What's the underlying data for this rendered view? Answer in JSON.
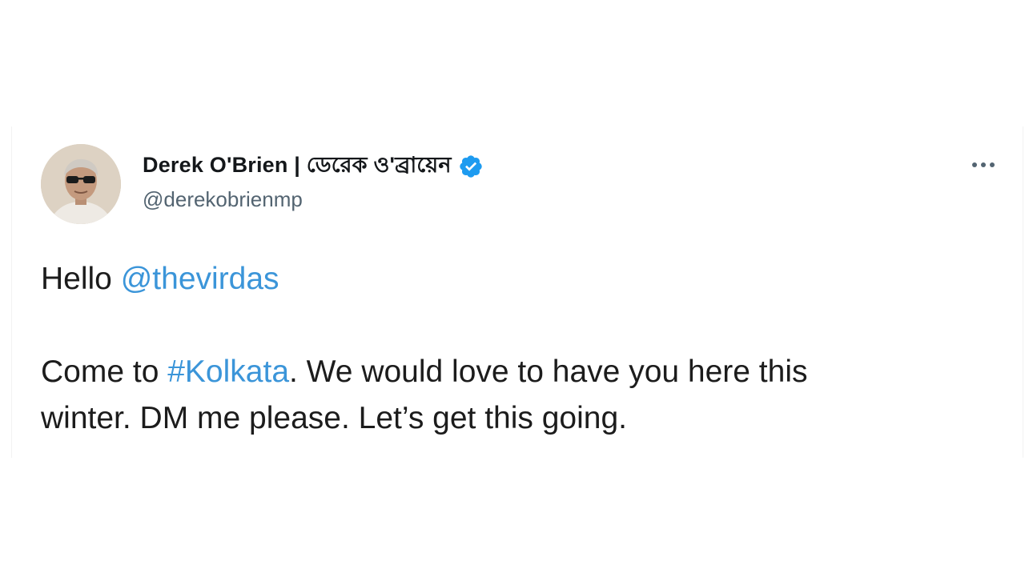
{
  "tweet": {
    "author": {
      "display_name": "Derek O'Brien | ডেরেক ও'ব্রায়েন",
      "handle": "@derekobrienmp",
      "verified": true,
      "avatar_icon": "profile-photo"
    },
    "more_icon": "more-horizontal-icon",
    "body": {
      "line1_prefix": "Hello ",
      "mention": "@thevirdas",
      "line2_prefix": "Come to ",
      "hashtag": "#Kolkata",
      "line2_suffix": ". We would love to have you here this",
      "line3": "winter. DM me please. Let’s get this going."
    }
  },
  "colors": {
    "link": "#3b95d9",
    "verified": "#1d9bf0",
    "text": "#1c1c1c",
    "secondary": "#536471"
  }
}
